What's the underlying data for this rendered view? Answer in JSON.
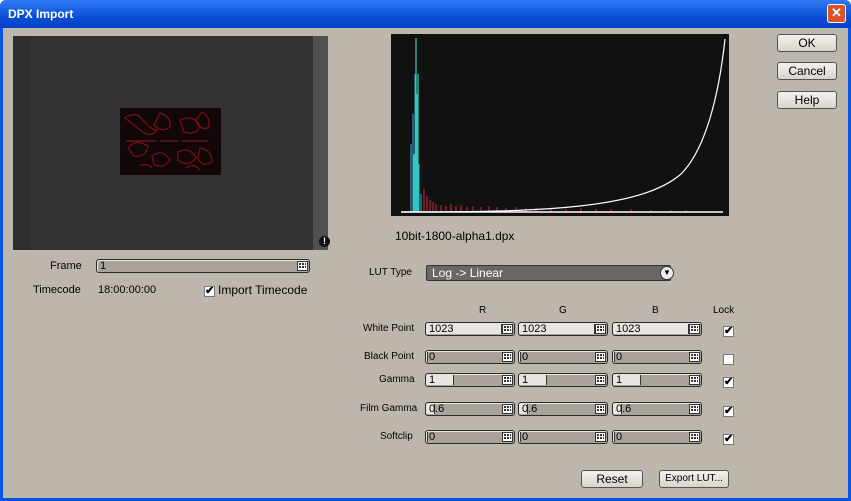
{
  "window": {
    "title": "DPX Import",
    "close_glyph": "✕"
  },
  "preview": {
    "warning_glyph": "!"
  },
  "frame": {
    "label": "Frame",
    "value": "1"
  },
  "timecode": {
    "label": "Timecode",
    "value": "18:00:00:00",
    "import_label": "Import Timecode",
    "import_checked": true
  },
  "histogram": {
    "filename": "10bit-1800-alpha1.dpx"
  },
  "lut": {
    "label": "LUT Type",
    "selected": "Log -> Linear"
  },
  "grid": {
    "columns": {
      "r": "R",
      "g": "G",
      "b": "B",
      "lock": "Lock"
    },
    "rows": [
      {
        "label": "White Point",
        "r": "1023",
        "g": "1023",
        "b": "1023",
        "fill": 1.0,
        "lock": true
      },
      {
        "label": "Black Point",
        "r": "0",
        "g": "0",
        "b": "0",
        "fill": 0.0,
        "lock": false
      },
      {
        "label": "Gamma",
        "r": "1",
        "g": "1",
        "b": "1",
        "fill": 0.35,
        "lock": true
      },
      {
        "label": "Film Gamma",
        "r": "0.6",
        "g": "0.6",
        "b": "0.6",
        "fill": 0.1,
        "lock": true
      },
      {
        "label": "Softclip",
        "r": "0",
        "g": "0",
        "b": "0",
        "fill": 0.0,
        "lock": true
      }
    ]
  },
  "buttons": {
    "ok": "OK",
    "cancel": "Cancel",
    "help": "Help",
    "reset": "Reset",
    "export": "Export LUT..."
  },
  "check_glyph": "✔"
}
